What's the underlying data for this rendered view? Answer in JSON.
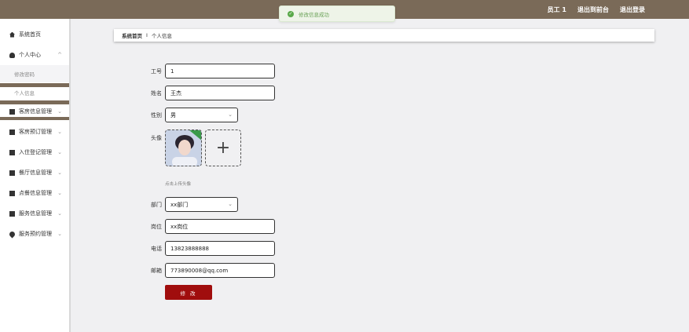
{
  "header": {
    "links": [
      "员工 1",
      "退出到前台",
      "退出登录"
    ]
  },
  "toast": {
    "text": "修改信息成功"
  },
  "sidebar": {
    "items": [
      {
        "label": "系统首页"
      },
      {
        "label": "个人中心"
      },
      {
        "label": "修改密码"
      },
      {
        "label": "个人信息"
      },
      {
        "label": "客房信息管理"
      },
      {
        "label": "客房预订管理"
      },
      {
        "label": "入住登记管理"
      },
      {
        "label": "餐厅信息管理"
      },
      {
        "label": "点餐信息管理"
      },
      {
        "label": "服务信息管理"
      },
      {
        "label": "服务预约管理"
      }
    ]
  },
  "breadcrumb": {
    "home": "系统首页",
    "sep": "I",
    "current": "个人信息"
  },
  "form": {
    "employee_no_label": "工号",
    "employee_no": "1",
    "name_label": "姓名",
    "name": "王杰",
    "gender_label": "性别",
    "gender": "男",
    "avatar_label": "头像",
    "upload_hint": "点击上传头像",
    "dept_label": "部门",
    "dept": "xx部门",
    "position_label": "岗位",
    "position": "xx岗位",
    "phone_label": "电话",
    "phone": "13823888888",
    "email_label": "邮箱",
    "email": "773890008@qq.com",
    "submit_label": "修 改"
  }
}
